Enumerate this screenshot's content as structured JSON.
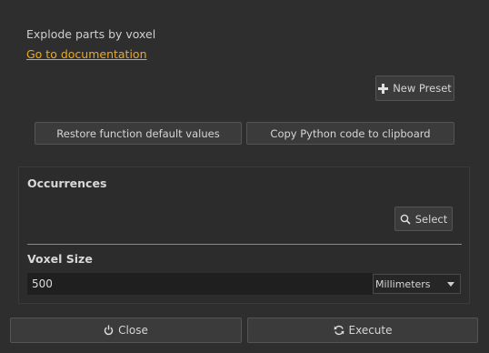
{
  "header": {
    "description": "Explode parts by voxel",
    "doc_link": "Go to documentation"
  },
  "toolbar": {
    "new_preset_label": "New Preset",
    "new_preset_icon": "plus-icon",
    "restore_label": "Restore function default values",
    "copy_label": "Copy Python code to clipboard"
  },
  "occurrences": {
    "title": "Occurrences",
    "select_label": "Select",
    "select_icon": "magnifier-icon"
  },
  "voxel": {
    "title": "Voxel Size",
    "value": "500",
    "unit": "Millimeters"
  },
  "footer": {
    "close_label": "Close",
    "close_icon": "power-icon",
    "execute_label": "Execute",
    "execute_icon": "refresh-icon"
  },
  "colors": {
    "background": "#2e2e2e",
    "link": "#f0a81a",
    "button": "#3b3b3b",
    "input": "#1f1f1f"
  }
}
